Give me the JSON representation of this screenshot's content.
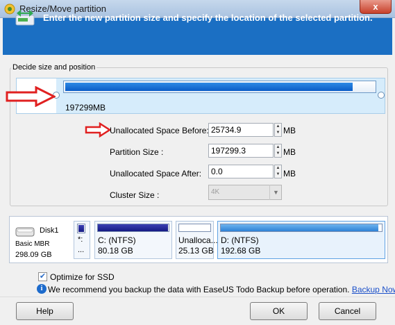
{
  "window": {
    "title": "Resize/Move partition",
    "close_label": "x"
  },
  "banner": {
    "text": "Enter the new partition size and specify the location of the selected partition."
  },
  "group": {
    "label": "Decide size and position"
  },
  "partition_preview": {
    "size_label": "197299MB"
  },
  "fields": {
    "before": {
      "label": "Unallocated Space Before:",
      "value": "25734.9",
      "unit": "MB"
    },
    "size": {
      "label": "Partition Size :",
      "value": "197299.3",
      "unit": "MB"
    },
    "after": {
      "label": "Unallocated Space After:",
      "value": "0.0",
      "unit": "MB"
    },
    "cluster": {
      "label": "Cluster Size :",
      "value": "4K"
    }
  },
  "disk": {
    "name": "Disk1",
    "type": "Basic MBR",
    "size": "298.09 GB",
    "partitions": [
      {
        "label": "*:",
        "size": "...",
        "fill": 0.85
      },
      {
        "label": "C: (NTFS)",
        "size": "80.18 GB",
        "fill": 0.97
      },
      {
        "label": "Unalloca...",
        "size": "25.13 GB",
        "fill": 0
      },
      {
        "label": "D: (NTFS)",
        "size": "192.68 GB",
        "fill": 0.97
      }
    ]
  },
  "options": {
    "optimize_ssd": "Optimize for SSD",
    "optimize_checked": true
  },
  "info": {
    "text": "We recommend you backup the data with EaseUS Todo Backup before operation.",
    "link": "Backup Now"
  },
  "buttons": {
    "help": "Help",
    "ok": "OK",
    "cancel": "Cancel"
  },
  "colors": {
    "banner": "#1b6fc3",
    "bar_fill": "#0a5cc7",
    "partition_fill": "#141a84",
    "arrow": "#e02020"
  }
}
